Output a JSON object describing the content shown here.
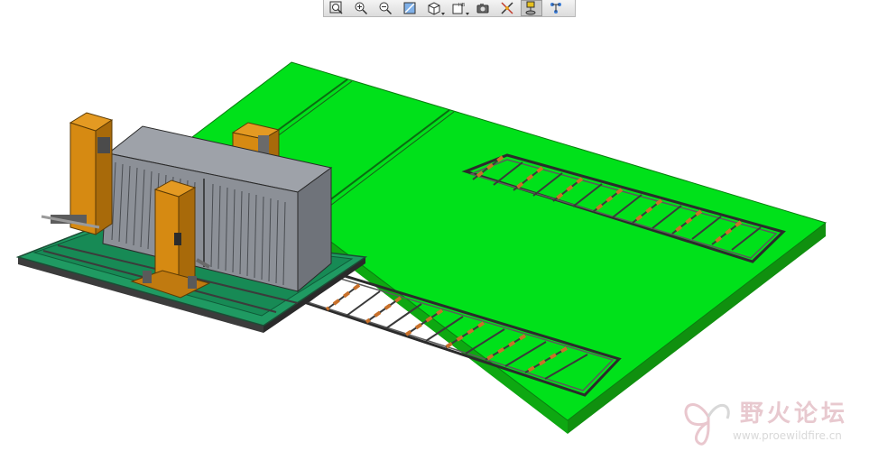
{
  "toolbar": {
    "buttons": [
      {
        "name": "zoom-window-icon"
      },
      {
        "name": "zoom-in-icon"
      },
      {
        "name": "zoom-out-icon"
      },
      {
        "name": "refit-icon"
      },
      {
        "name": "saved-view-icon"
      },
      {
        "name": "named-view-list-icon"
      },
      {
        "name": "spin-center-icon"
      },
      {
        "name": "datum-planes-icon"
      },
      {
        "name": "datum-axes-icon"
      },
      {
        "name": "model-tree-icon"
      }
    ]
  },
  "colors": {
    "floor": "#00e11a",
    "equipment_orange": "#d68a12",
    "cabinet_gray": "#8c9097",
    "base_teal": "#1f9a62",
    "roller": "#c8702a"
  },
  "watermark": {
    "title": "野火论坛",
    "url": "www.proewildfire.cn"
  }
}
